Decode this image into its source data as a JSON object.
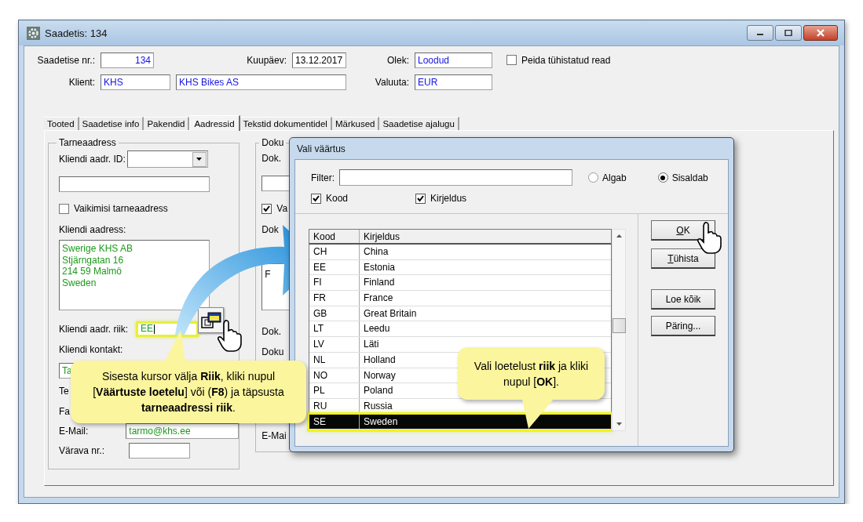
{
  "window": {
    "title": "Saadetis: 134"
  },
  "header": {
    "number": {
      "label": "Saadetise nr.:",
      "value": "134"
    },
    "date": {
      "label": "Kuupäev:",
      "value": "13.12.2017"
    },
    "status": {
      "label": "Olek:",
      "value": "Loodud"
    },
    "hide_cancelled": {
      "label": "Peida tühistatud read",
      "checked": false
    },
    "client": {
      "label": "Klient:",
      "code": "KHS",
      "name": "KHS Bikes AS"
    },
    "currency": {
      "label": "Valuuta:",
      "value": "EUR"
    }
  },
  "tabs": [
    {
      "label": "Tooted",
      "selected": false
    },
    {
      "label": "Saadetise info",
      "selected": false
    },
    {
      "label": "Pakendid",
      "selected": false
    },
    {
      "label": "Aadressid",
      "selected": true
    },
    {
      "label": "Tekstid dokumentidel",
      "selected": false
    },
    {
      "label": "Märkused",
      "selected": false
    },
    {
      "label": "Saadetise ajalugu",
      "selected": false
    }
  ],
  "delivery_address": {
    "title": "Tarneaadress",
    "address_id_label": "Kliendi aadr. ID:",
    "default_address": {
      "label": "Vaikimisi tarneaadress",
      "checked": false
    },
    "address_label": "Kliendi aadress:",
    "address_lines": [
      "Swerige KHS AB",
      "Stjärngatan 16",
      "214 59 Malmö",
      "Sweden"
    ],
    "country_label": "Kliendi aadr. riik:",
    "country_value": "EE",
    "contact_label": "Kliendi kontakt:",
    "contact_value": "Ta",
    "phone_label": "Te",
    "fax_label": "Fa",
    "email_label": "E-Mail:",
    "email_value": "tarmo@khs.ee",
    "gate_label": "Värava nr.:"
  },
  "document_group": {
    "title": "Doku",
    "label_1": "Dok.",
    "checkbox": {
      "label": "Va",
      "checked": true
    },
    "label_2": "Dok",
    "note_text": "F",
    "label_3": "Dok.",
    "label_4": "Doku",
    "label_5": "E-Mai"
  },
  "dialog": {
    "title": "Vali väärtus",
    "filter_label": "Filter:",
    "match_options": [
      {
        "label": "Algab",
        "selected": false
      },
      {
        "label": "Sisaldab",
        "selected": true
      }
    ],
    "search_in": [
      {
        "label": "Kood",
        "checked": true
      },
      {
        "label": "Kirjeldus",
        "checked": true
      }
    ],
    "table": {
      "columns": [
        "Kood",
        "Kirjeldus"
      ],
      "rows": [
        {
          "cells": [
            "CH",
            "China"
          ],
          "selected": false
        },
        {
          "cells": [
            "EE",
            "Estonia"
          ],
          "selected": false
        },
        {
          "cells": [
            "FI",
            "Finland"
          ],
          "selected": false
        },
        {
          "cells": [
            "FR",
            "France"
          ],
          "selected": false
        },
        {
          "cells": [
            "GB",
            "Great Britain"
          ],
          "selected": false
        },
        {
          "cells": [
            "LT",
            "Leedu"
          ],
          "selected": false
        },
        {
          "cells": [
            "LV",
            "Läti"
          ],
          "selected": false
        },
        {
          "cells": [
            "NL",
            "Holland"
          ],
          "selected": false
        },
        {
          "cells": [
            "NO",
            "Norway"
          ],
          "selected": false
        },
        {
          "cells": [
            "PL",
            "Poland"
          ],
          "selected": false
        },
        {
          "cells": [
            "RU",
            "Russia"
          ],
          "selected": false
        },
        {
          "cells": [
            "SE",
            "Sweden"
          ],
          "selected": true
        }
      ]
    },
    "buttons": [
      {
        "label": "OK",
        "mnemonic": true
      },
      {
        "label": "Tühista",
        "mnemonic": true
      },
      {
        "label": "Loe kõik",
        "mnemonic": false
      },
      {
        "label": "Päring...",
        "mnemonic": false
      }
    ]
  },
  "callouts": [
    {
      "text": "Sisesta kursor välja **Riik**, kliki nupul [**Väärtuste loetelu**] või (**F8**) ja täpsusta **tarneaadressi riik**."
    },
    {
      "text": "Vali loetelust **riik** ja kliki nupul [**OK**]."
    }
  ]
}
